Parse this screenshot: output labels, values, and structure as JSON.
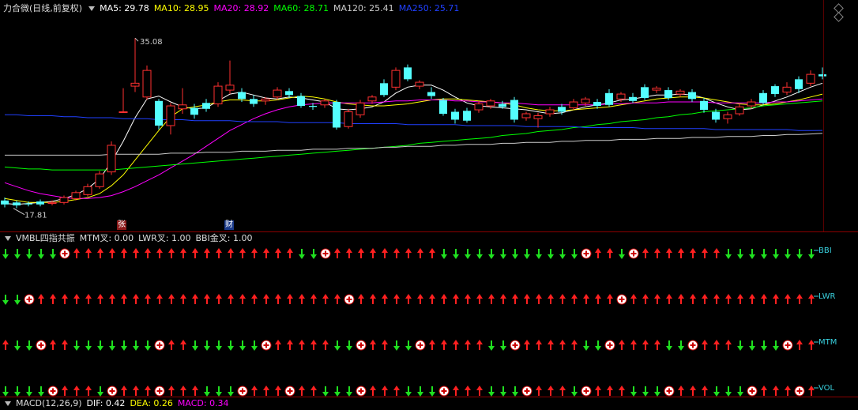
{
  "main": {
    "title": "力合微(日线,前复权)",
    "ma": [
      {
        "label": "MA5: 29.78",
        "color": "#ffffff"
      },
      {
        "label": "MA10: 28.95",
        "color": "#ffff00"
      },
      {
        "label": "MA20: 28.92",
        "color": "#ff00ff"
      },
      {
        "label": "MA60: 28.71",
        "color": "#00ff00"
      },
      {
        "label": "MA120: 25.41",
        "color": "#cccccc"
      },
      {
        "label": "MA250: 25.71",
        "color": "#2040ff"
      }
    ],
    "high_label": "35.08",
    "low_label": "17.81",
    "badge_zhang": "张",
    "badge_cai": "财"
  },
  "chart_data": {
    "type": "candlestick",
    "ylim": [
      16.5,
      37.5
    ],
    "candles": [
      {
        "o": 18.2,
        "c": 18.6,
        "h": 18.9,
        "l": 17.9,
        "up": false
      },
      {
        "o": 18.1,
        "c": 18.4,
        "h": 18.6,
        "l": 17.81,
        "up": false
      },
      {
        "o": 18.3,
        "c": 18.2,
        "h": 18.5,
        "l": 18.0,
        "up": false
      },
      {
        "o": 18.2,
        "c": 18.5,
        "h": 18.7,
        "l": 18.0,
        "up": false
      },
      {
        "o": 18.3,
        "c": 18.4,
        "h": 18.6,
        "l": 18.1,
        "up": true
      },
      {
        "o": 18.4,
        "c": 18.9,
        "h": 19.1,
        "l": 18.2,
        "up": true
      },
      {
        "o": 18.8,
        "c": 19.4,
        "h": 19.6,
        "l": 18.6,
        "up": true
      },
      {
        "o": 19.2,
        "c": 20.0,
        "h": 20.3,
        "l": 19.0,
        "up": true
      },
      {
        "o": 20.0,
        "c": 21.3,
        "h": 21.6,
        "l": 19.8,
        "up": true
      },
      {
        "o": 21.5,
        "c": 24.2,
        "h": 24.6,
        "l": 21.2,
        "up": true
      },
      {
        "o": 27.6,
        "c": 27.6,
        "h": 30.0,
        "l": 27.6,
        "up": true
      },
      {
        "o": 30.2,
        "c": 30.5,
        "h": 35.08,
        "l": 29.6,
        "up": true
      },
      {
        "o": 29.1,
        "c": 31.8,
        "h": 32.3,
        "l": 28.8,
        "up": true
      },
      {
        "o": 28.7,
        "c": 26.2,
        "h": 28.9,
        "l": 25.8,
        "up": false
      },
      {
        "o": 26.2,
        "c": 28.2,
        "h": 28.5,
        "l": 25.3,
        "up": true
      },
      {
        "o": 27.9,
        "c": 28.3,
        "h": 30.0,
        "l": 27.4,
        "up": true
      },
      {
        "o": 28.0,
        "c": 27.3,
        "h": 28.4,
        "l": 26.9,
        "up": false
      },
      {
        "o": 27.9,
        "c": 28.5,
        "h": 28.9,
        "l": 27.6,
        "up": false
      },
      {
        "o": 28.4,
        "c": 30.2,
        "h": 30.6,
        "l": 28.1,
        "up": true
      },
      {
        "o": 29.8,
        "c": 30.3,
        "h": 32.8,
        "l": 29.4,
        "up": true
      },
      {
        "o": 29.6,
        "c": 28.9,
        "h": 30.0,
        "l": 28.6,
        "up": false
      },
      {
        "o": 28.9,
        "c": 28.4,
        "h": 29.3,
        "l": 28.1,
        "up": false
      },
      {
        "o": 28.7,
        "c": 28.9,
        "h": 29.1,
        "l": 28.3,
        "up": true
      },
      {
        "o": 29.1,
        "c": 29.8,
        "h": 30.1,
        "l": 28.8,
        "up": true
      },
      {
        "o": 29.7,
        "c": 29.3,
        "h": 30.0,
        "l": 29.0,
        "up": false
      },
      {
        "o": 29.2,
        "c": 28.2,
        "h": 29.5,
        "l": 28.0,
        "up": false
      },
      {
        "o": 28.2,
        "c": 28.1,
        "h": 28.5,
        "l": 27.8,
        "up": false
      },
      {
        "o": 28.3,
        "c": 28.7,
        "h": 28.9,
        "l": 28.0,
        "up": true
      },
      {
        "o": 28.6,
        "c": 26.0,
        "h": 28.8,
        "l": 25.8,
        "up": false
      },
      {
        "o": 26.1,
        "c": 27.6,
        "h": 27.9,
        "l": 25.9,
        "up": true
      },
      {
        "o": 27.3,
        "c": 28.5,
        "h": 28.8,
        "l": 27.0,
        "up": true
      },
      {
        "o": 28.7,
        "c": 29.1,
        "h": 29.3,
        "l": 28.4,
        "up": true
      },
      {
        "o": 29.3,
        "c": 30.5,
        "h": 30.9,
        "l": 29.1,
        "up": false
      },
      {
        "o": 30.1,
        "c": 31.8,
        "h": 32.1,
        "l": 29.8,
        "up": true
      },
      {
        "o": 32.1,
        "c": 30.9,
        "h": 32.4,
        "l": 30.7,
        "up": false
      },
      {
        "o": 30.2,
        "c": 30.6,
        "h": 30.8,
        "l": 29.9,
        "up": true
      },
      {
        "o": 29.6,
        "c": 29.2,
        "h": 30.1,
        "l": 28.9,
        "up": false
      },
      {
        "o": 28.8,
        "c": 27.4,
        "h": 29.0,
        "l": 27.2,
        "up": false
      },
      {
        "o": 27.6,
        "c": 26.8,
        "h": 27.9,
        "l": 26.4,
        "up": false
      },
      {
        "o": 26.7,
        "c": 27.7,
        "h": 28.0,
        "l": 26.5,
        "up": false
      },
      {
        "o": 27.8,
        "c": 28.4,
        "h": 28.7,
        "l": 27.5,
        "up": true
      },
      {
        "o": 28.2,
        "c": 28.7,
        "h": 28.9,
        "l": 27.9,
        "up": true
      },
      {
        "o": 28.4,
        "c": 28.1,
        "h": 28.7,
        "l": 27.9,
        "up": false
      },
      {
        "o": 28.8,
        "c": 26.8,
        "h": 29.1,
        "l": 26.5,
        "up": false
      },
      {
        "o": 27.0,
        "c": 27.4,
        "h": 27.6,
        "l": 26.7,
        "up": true
      },
      {
        "o": 27.2,
        "c": 26.9,
        "h": 27.5,
        "l": 26.0,
        "up": true
      },
      {
        "o": 27.4,
        "c": 27.8,
        "h": 28.1,
        "l": 27.1,
        "up": true
      },
      {
        "o": 27.6,
        "c": 28.1,
        "h": 28.4,
        "l": 27.3,
        "up": false
      },
      {
        "o": 28.0,
        "c": 28.6,
        "h": 28.9,
        "l": 27.8,
        "up": true
      },
      {
        "o": 28.5,
        "c": 28.9,
        "h": 29.1,
        "l": 28.2,
        "up": true
      },
      {
        "o": 28.6,
        "c": 28.2,
        "h": 28.9,
        "l": 27.9,
        "up": false
      },
      {
        "o": 28.3,
        "c": 29.5,
        "h": 29.9,
        "l": 28.1,
        "up": false
      },
      {
        "o": 28.9,
        "c": 29.4,
        "h": 29.6,
        "l": 28.6,
        "up": true
      },
      {
        "o": 29.1,
        "c": 28.7,
        "h": 29.5,
        "l": 28.5,
        "up": false
      },
      {
        "o": 29.0,
        "c": 30.1,
        "h": 30.4,
        "l": 28.8,
        "up": false
      },
      {
        "o": 29.8,
        "c": 30.0,
        "h": 30.2,
        "l": 29.5,
        "up": true
      },
      {
        "o": 29.8,
        "c": 29.0,
        "h": 30.1,
        "l": 28.8,
        "up": false
      },
      {
        "o": 29.4,
        "c": 29.7,
        "h": 29.9,
        "l": 29.1,
        "up": true
      },
      {
        "o": 29.6,
        "c": 28.9,
        "h": 29.9,
        "l": 28.6,
        "up": false
      },
      {
        "o": 28.7,
        "c": 27.8,
        "h": 29.0,
        "l": 27.5,
        "up": false
      },
      {
        "o": 27.6,
        "c": 26.8,
        "h": 27.9,
        "l": 26.5,
        "up": false
      },
      {
        "o": 26.9,
        "c": 27.3,
        "h": 27.6,
        "l": 26.4,
        "up": true
      },
      {
        "o": 27.4,
        "c": 28.1,
        "h": 28.4,
        "l": 27.2,
        "up": true
      },
      {
        "o": 28.2,
        "c": 28.6,
        "h": 28.9,
        "l": 27.9,
        "up": true
      },
      {
        "o": 28.5,
        "c": 29.5,
        "h": 29.8,
        "l": 28.3,
        "up": false
      },
      {
        "o": 29.4,
        "c": 30.2,
        "h": 30.4,
        "l": 29.1,
        "up": false
      },
      {
        "o": 29.6,
        "c": 30.1,
        "h": 30.6,
        "l": 29.3,
        "up": true
      },
      {
        "o": 29.9,
        "c": 30.9,
        "h": 31.2,
        "l": 29.5,
        "up": false
      },
      {
        "o": 30.5,
        "c": 31.4,
        "h": 31.8,
        "l": 30.2,
        "up": true
      },
      {
        "o": 31.4,
        "c": 31.2,
        "h": 32.1,
        "l": 30.9,
        "up": false
      }
    ],
    "ma_lines": [
      {
        "name": "MA5",
        "color": "#ffffff",
        "values": [
          18.3,
          18.2,
          18.3,
          18.4,
          18.5,
          18.8,
          19.2,
          19.8,
          20.8,
          22.5,
          24.6,
          27.0,
          28.9,
          29.2,
          28.6,
          28.1,
          27.9,
          28.0,
          28.7,
          29.4,
          29.6,
          29.3,
          29.0,
          28.9,
          29.1,
          29.0,
          28.8,
          28.6,
          27.9,
          27.8,
          27.9,
          28.1,
          28.6,
          29.5,
          30.1,
          30.3,
          30.3,
          29.8,
          29.1,
          28.5,
          28.2,
          28.1,
          28.0,
          27.9,
          27.8,
          27.6,
          27.4,
          27.5,
          27.8,
          28.1,
          28.3,
          28.5,
          28.8,
          28.9,
          29.1,
          29.3,
          29.3,
          29.4,
          29.3,
          29.0,
          28.5,
          28.1,
          27.8,
          27.9,
          28.3,
          28.7,
          29.1,
          29.6,
          30.1,
          30.5
        ]
      },
      {
        "name": "MA10",
        "color": "#ffff00",
        "values": [
          18.8,
          18.6,
          18.4,
          18.4,
          18.4,
          18.5,
          18.7,
          18.9,
          19.3,
          20.1,
          21.2,
          22.7,
          24.2,
          25.7,
          27.1,
          27.9,
          28.1,
          28.3,
          28.6,
          28.8,
          28.8,
          28.7,
          28.7,
          28.8,
          29.0,
          29.2,
          29.1,
          28.9,
          28.6,
          28.4,
          28.3,
          28.2,
          28.2,
          28.3,
          28.4,
          28.6,
          28.8,
          28.9,
          28.9,
          28.8,
          28.7,
          28.6,
          28.5,
          28.3,
          28.0,
          27.8,
          27.7,
          27.7,
          27.8,
          27.9,
          28.0,
          28.1,
          28.3,
          28.5,
          28.7,
          28.9,
          29.0,
          29.1,
          29.1,
          29.0,
          28.8,
          28.6,
          28.4,
          28.3,
          28.3,
          28.4,
          28.6,
          28.8,
          29.1,
          29.4
        ]
      },
      {
        "name": "MA20",
        "color": "#ff00ff",
        "values": [
          20.4,
          20.0,
          19.6,
          19.3,
          19.1,
          18.9,
          18.8,
          18.8,
          18.9,
          19.1,
          19.5,
          20.0,
          20.6,
          21.2,
          21.9,
          22.6,
          23.3,
          24.1,
          24.9,
          25.7,
          26.3,
          26.9,
          27.4,
          27.8,
          28.1,
          28.3,
          28.4,
          28.5,
          28.5,
          28.5,
          28.5,
          28.5,
          28.6,
          28.7,
          28.7,
          28.8,
          28.8,
          28.8,
          28.7,
          28.7,
          28.6,
          28.6,
          28.5,
          28.5,
          28.4,
          28.3,
          28.3,
          28.3,
          28.3,
          28.3,
          28.3,
          28.4,
          28.4,
          28.5,
          28.5,
          28.5,
          28.6,
          28.6,
          28.6,
          28.6,
          28.5,
          28.5,
          28.5,
          28.5,
          28.5,
          28.6,
          28.6,
          28.7,
          28.8,
          28.9
        ]
      },
      {
        "name": "MA60",
        "color": "#00ff00",
        "values": [
          22.0,
          21.9,
          21.8,
          21.8,
          21.7,
          21.7,
          21.7,
          21.7,
          21.7,
          21.7,
          21.8,
          21.9,
          22.0,
          22.1,
          22.2,
          22.3,
          22.4,
          22.5,
          22.6,
          22.7,
          22.8,
          22.9,
          23.0,
          23.1,
          23.2,
          23.3,
          23.4,
          23.5,
          23.6,
          23.7,
          23.8,
          23.9,
          24.0,
          24.1,
          24.2,
          24.4,
          24.5,
          24.6,
          24.7,
          24.8,
          24.9,
          25.0,
          25.2,
          25.3,
          25.4,
          25.6,
          25.7,
          25.8,
          26.0,
          26.1,
          26.3,
          26.4,
          26.6,
          26.7,
          26.8,
          27.0,
          27.1,
          27.3,
          27.4,
          27.6,
          27.7,
          27.8,
          27.9,
          28.0,
          28.2,
          28.3,
          28.4,
          28.5,
          28.6,
          28.71
        ]
      },
      {
        "name": "MA120",
        "color": "#cccccc",
        "values": [
          23.2,
          23.2,
          23.2,
          23.2,
          23.2,
          23.2,
          23.2,
          23.2,
          23.2,
          23.3,
          23.3,
          23.3,
          23.3,
          23.3,
          23.4,
          23.4,
          23.4,
          23.5,
          23.5,
          23.5,
          23.6,
          23.6,
          23.6,
          23.7,
          23.7,
          23.7,
          23.8,
          23.8,
          23.8,
          23.9,
          23.9,
          23.9,
          24.0,
          24.0,
          24.1,
          24.1,
          24.1,
          24.2,
          24.2,
          24.3,
          24.3,
          24.3,
          24.4,
          24.4,
          24.5,
          24.5,
          24.5,
          24.6,
          24.6,
          24.7,
          24.7,
          24.7,
          24.8,
          24.8,
          24.8,
          24.9,
          24.9,
          24.9,
          25.0,
          25.0,
          25.0,
          25.1,
          25.1,
          25.1,
          25.2,
          25.2,
          25.3,
          25.3,
          25.35,
          25.41
        ]
      },
      {
        "name": "MA250",
        "color": "#2040ff",
        "values": [
          27.3,
          27.3,
          27.2,
          27.2,
          27.2,
          27.1,
          27.1,
          27.0,
          27.0,
          27.0,
          26.9,
          26.9,
          26.9,
          26.8,
          26.8,
          26.8,
          26.7,
          26.7,
          26.7,
          26.7,
          26.6,
          26.6,
          26.6,
          26.6,
          26.5,
          26.5,
          26.5,
          26.5,
          26.5,
          26.4,
          26.4,
          26.4,
          26.4,
          26.4,
          26.3,
          26.3,
          26.3,
          26.3,
          26.3,
          26.2,
          26.2,
          26.2,
          26.2,
          26.2,
          26.1,
          26.1,
          26.1,
          26.1,
          26.1,
          26.0,
          26.0,
          26.0,
          26.0,
          26.0,
          25.9,
          25.9,
          25.9,
          25.9,
          25.9,
          25.9,
          25.8,
          25.8,
          25.8,
          25.8,
          25.8,
          25.8,
          25.8,
          25.7,
          25.7,
          25.71
        ]
      }
    ]
  },
  "indicator": {
    "title": "VMBL四指共振",
    "labels": [
      "MTM叉: 0.00",
      "LWR叉: 1.00",
      "BBI金叉: 1.00"
    ],
    "rows": [
      {
        "name": "BBI",
        "signals": "gggggcrrrrrrrrrrrrrrrrrrrggcrrrrrrrrrggggggggggggcrrgcrrrrrrrgggggggggggcrrrrrr"
      },
      {
        "name": "LWR",
        "signals": "ggcrrrrrrrrrrrrrrrrrrrrrrrrrrcrrrrrrrrrrrrrrrrrrrrrrcrrrrrrrrrrrrrrrrgggcrrrrr"
      },
      {
        "name": "MTM",
        "signals": "rggcrrgggggggcrrggggggcrrrrrggcrrggcrrrrrggcrrrrrggcrrrrggcrrrggggcrrrrrcrrggg"
      },
      {
        "name": "VOL",
        "signals": "ggggcrrrgcrrrcrrrgggcrrrcrrgggcrrrgggcrrrgggcrrrgcrrrgggcrrrgggcrrrcrrrggcrrrg"
      }
    ]
  },
  "macd": {
    "label": "MACD(12,26,9)",
    "dif": "DIF: 0.42",
    "dea": "DEA: 0.26",
    "macd": "MACD: 0.34"
  }
}
